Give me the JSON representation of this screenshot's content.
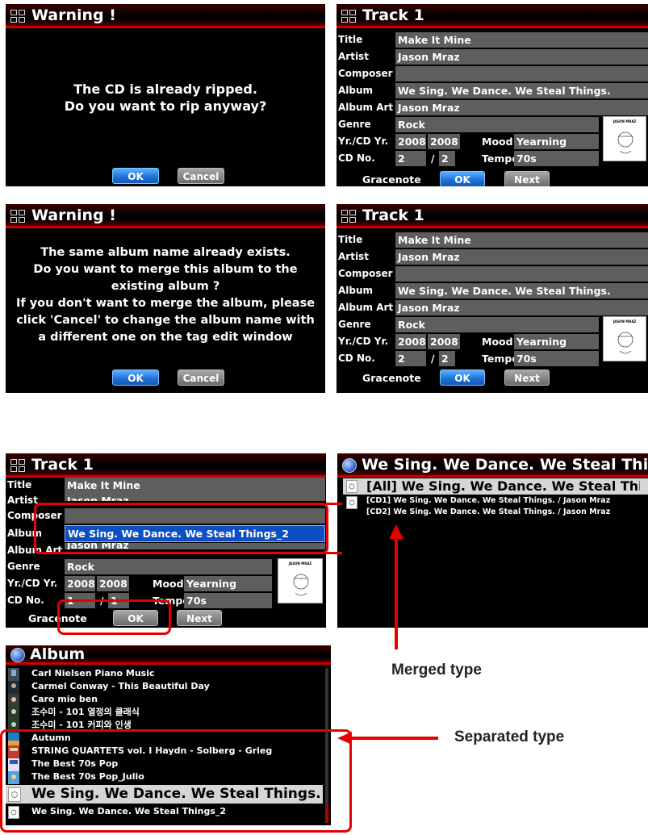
{
  "common": {
    "ok_label": "OK",
    "cancel_label": "Cancel",
    "next_label": "Next",
    "gracenote_label": "Gracenote",
    "slash": "/"
  },
  "warning1": {
    "title": "Warning !",
    "lines": [
      "The CD is already ripped.",
      "Do you want to rip anyway?"
    ]
  },
  "warning2": {
    "title": "Warning !",
    "lines": [
      "The same album name already exists.",
      "Do you want to merge this album to the",
      "existing album ?",
      "If you don't want to merge the album, please",
      "click 'Cancel' to change the album name with",
      "a different one on the tag edit window"
    ]
  },
  "track_labels": {
    "title": "Title",
    "artist": "Artist",
    "composer": "Composer",
    "album": "Album",
    "album_art": "Album Art",
    "genre": "Genre",
    "yr": "Yr./CD Yr.",
    "cd_no": "CD No.",
    "mood": "Mood",
    "tempo": "Tempo"
  },
  "track1": {
    "header": "Track 1",
    "title": "Make It Mine",
    "artist": "Jason Mraz",
    "composer": "",
    "album": "We Sing. We Dance. We Steal Things.",
    "album_art": "Jason Mraz",
    "genre": "Rock",
    "yr": "2008",
    "cd_yr": "2008",
    "mood": "Yearning",
    "cd_no": "2",
    "cd_total": "2",
    "tempo": "70s",
    "art_caption": "JASON MRAZ"
  },
  "track2": {
    "header": "Track 1",
    "title": "Make It Mine",
    "artist": "Jason Mraz",
    "composer": "",
    "album": "We Sing. We Dance. We Steal Things.",
    "album_art": "Jason Mraz",
    "genre": "Rock",
    "yr": "2008",
    "cd_yr": "2008",
    "mood": "Yearning",
    "cd_no": "2",
    "cd_total": "2",
    "tempo": "70s",
    "art_caption": "JASON MRAZ"
  },
  "track3": {
    "header": "Track 1",
    "title": "Make It Mine",
    "artist": "Jason Mraz",
    "composer": "",
    "album": "We Sing. We Dance. We Steal Things_2",
    "album_art": "Jason Mraz",
    "genre": "Rock",
    "yr": "2008",
    "cd_yr": "2008",
    "mood": "Yearning",
    "cd_no": "1",
    "cd_total": "1",
    "tempo": "70s",
    "art_caption": "JASON MRAZ"
  },
  "merged_panel": {
    "title": "We Sing. We Dance. We Steal Things.",
    "items": [
      "[All] We Sing. We Dance. We Steal Things.",
      "[CD1] We Sing. We Dance. We Steal Things. / Jason Mraz",
      "[CD2] We Sing. We Dance. We Steal Things. / Jason Mraz"
    ]
  },
  "album_panel": {
    "title": "Album",
    "items": [
      "Carl Nielsen Piano Music",
      "Carmel Conway - This Beautiful Day",
      "Caro mio ben",
      "조수미 - 101 열정의 클래식",
      "조수미 - 101 커피와 인생",
      "Autumn",
      "STRING QUARTETS vol. I Haydn - Solberg - Grieg",
      "The Best 70s Pop",
      "The Best 70s Pop_Julio",
      "We Sing. We Dance. We Steal Things.",
      "We Sing. We Dance. We Steal Things_2"
    ]
  },
  "captions": {
    "merged": "Merged type",
    "separated": "Separated type"
  },
  "colors": {
    "accent_red": "#e60000",
    "field_gray": "#5e5e5e",
    "highlight_blue": "#0c4fc4",
    "button_blue": "#1d6fd6"
  }
}
